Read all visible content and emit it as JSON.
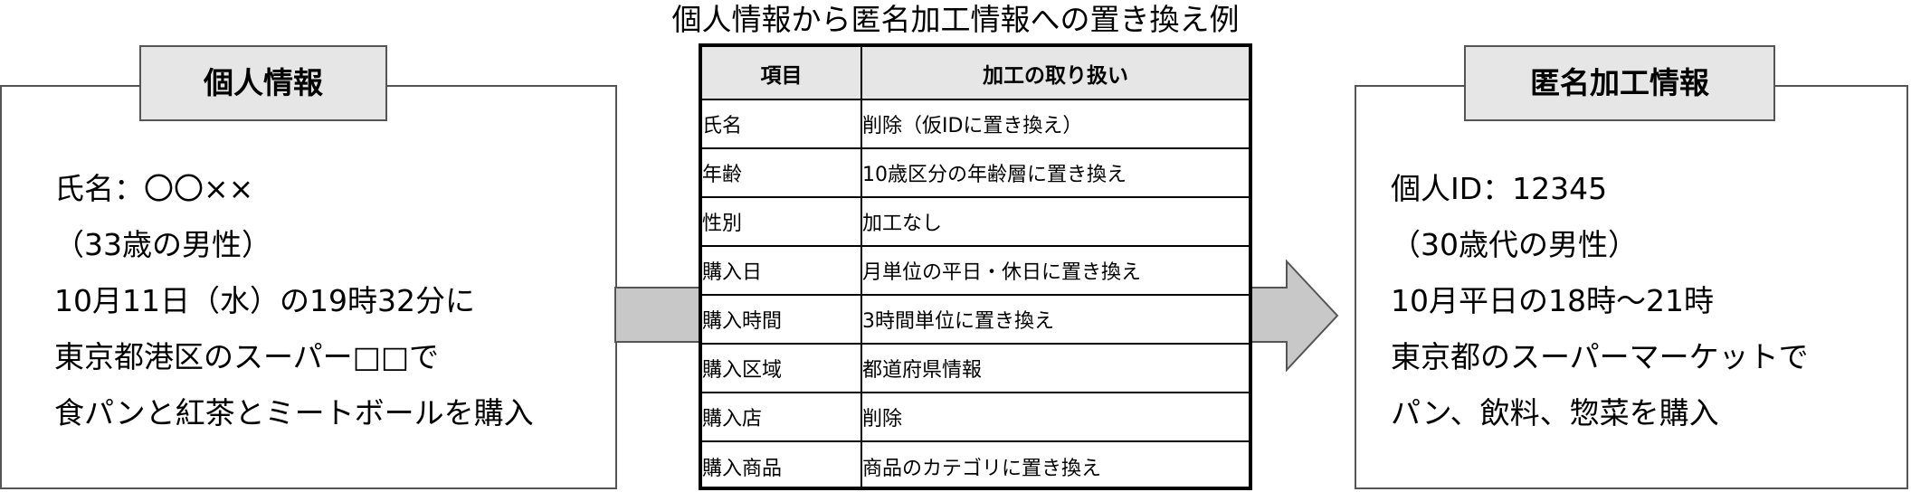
{
  "title": "個人情報から匿名加工情報への置き換え例",
  "left_panel": {
    "header": "個人情報",
    "lines": [
      "氏名：〇〇××",
      "（33歳の男性）",
      "10月11日（水）の19時32分に",
      "東京都港区のスーパー□□で",
      "食パンと紅茶とミートボールを購入"
    ]
  },
  "right_panel": {
    "header": "匿名加工情報",
    "lines": [
      "個人ID：12345",
      "（30歳代の男性）",
      "10月平日の18時～21時",
      "東京都のスーパーマーケットで",
      "パン、飲料、惣菜を購入"
    ]
  },
  "table": {
    "headers": [
      "項目",
      "加工の取り扱い"
    ],
    "rows": [
      {
        "item": "氏名",
        "processing": "削除（仮IDに置き換え）"
      },
      {
        "item": "年齢",
        "processing": "10歳区分の年齢層に置き換え"
      },
      {
        "item": "性別",
        "processing": "加工なし"
      },
      {
        "item": "購入日",
        "processing": "月単位の平日・休日に置き換え"
      },
      {
        "item": "購入時間",
        "processing": "3時間単位に置き換え"
      },
      {
        "item": "購入区域",
        "processing": "都道府県情報"
      },
      {
        "item": "購入店",
        "processing": "削除"
      },
      {
        "item": "購入商品",
        "processing": "商品のカテゴリに置き換え"
      }
    ]
  },
  "colors": {
    "header_fill": "#e6e6e6",
    "arrow_fill": "#c8c8c8",
    "border": "#555555"
  }
}
